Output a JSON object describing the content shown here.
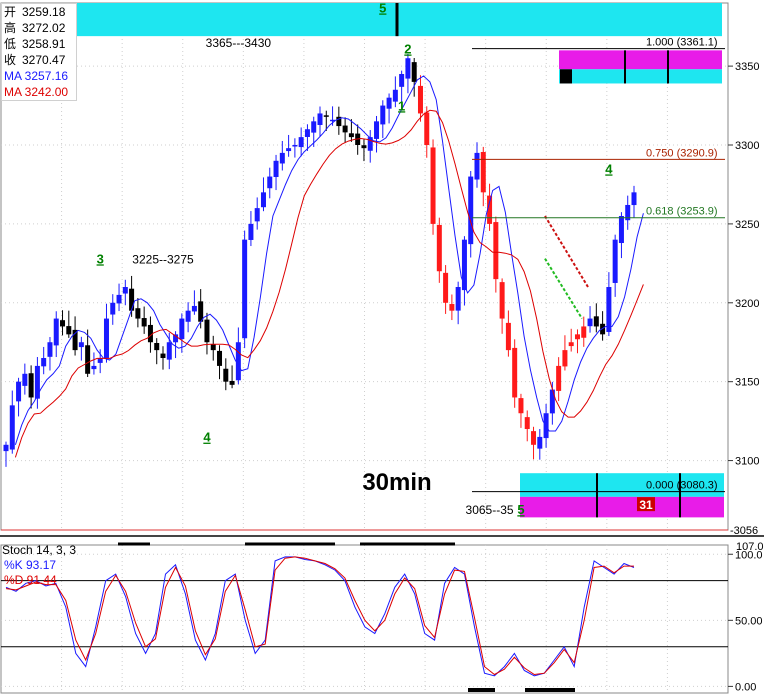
{
  "ohlc_panel": {
    "rows": [
      {
        "label": "开",
        "value": "3259.18"
      },
      {
        "label": "高",
        "value": "3272.02"
      },
      {
        "label": "低",
        "value": "3258.91"
      },
      {
        "label": "收",
        "value": "3270.47"
      }
    ],
    "ma_blue": "MA 3257.16",
    "ma_red": "MA 3242.00"
  },
  "stoch_panel": {
    "title": "Stoch 14, 3, 3",
    "k_text": "%K  93.17",
    "d_text": "%D  91.44"
  },
  "colors": {
    "bull": "#1a1aff",
    "bear": "#ff1a1a",
    "neutral_candle": "#000000",
    "cyan_zone": "#1ee6f0",
    "magenta_zone": "#e81ce8",
    "ma_blue": "#1a1aff",
    "ma_red": "#dd0000",
    "wave_label": "#008000",
    "fib_red": "#aa2200",
    "fib_green": "#227722"
  },
  "chart_data": [
    {
      "type": "candlestick",
      "title": "",
      "watermark": "30min",
      "ylim": [
        3056,
        3390
      ],
      "y_ticks": [
        3100,
        3150,
        3200,
        3250,
        3300,
        3350
      ],
      "y_last_price_tag": "3056",
      "close_path": [
        3110,
        3135,
        3150,
        3155,
        3140,
        3160,
        3165,
        3175,
        3190,
        3185,
        3180,
        3170,
        3175,
        3155,
        3160,
        3165,
        3190,
        3200,
        3205,
        3210,
        3195,
        3190,
        3185,
        3175,
        3170,
        3165,
        3175,
        3180,
        3190,
        3195,
        3198,
        3188,
        3175,
        3170,
        3160,
        3150,
        3148,
        3175,
        3240,
        3250,
        3260,
        3270,
        3280,
        3290,
        3295,
        3298,
        3300,
        3305,
        3310,
        3315,
        3320,
        3318,
        3316,
        3312,
        3308,
        3305,
        3300,
        3298,
        3305,
        3315,
        3325,
        3330,
        3335,
        3345,
        3355,
        3340,
        3320,
        3300,
        3250,
        3220,
        3200,
        3195,
        3210,
        3240,
        3280,
        3295,
        3270,
        3250,
        3215,
        3190,
        3170,
        3140,
        3130,
        3120,
        3110,
        3115,
        3130,
        3145,
        3160,
        3170,
        3175,
        3180,
        3185,
        3190,
        3185,
        3180,
        3210,
        3240,
        3255,
        3262,
        3270
      ],
      "wave_labels": [
        {
          "text": "5",
          "x_index": 60,
          "price": 3384
        },
        {
          "text": "2",
          "x_index": 64,
          "price": 3358
        },
        {
          "text": "1",
          "x_index": 63,
          "price": 3322
        },
        {
          "text": "3",
          "x_index": 15,
          "price": 3225
        },
        {
          "text": "4",
          "x_index": 32,
          "price": 3112
        },
        {
          "text": "4",
          "x_index": 96,
          "price": 3282
        },
        {
          "text": "5",
          "x_index": 82,
          "price": 3066
        }
      ],
      "annotations": [
        {
          "text": "3365---3430",
          "x_index": 37,
          "price": 3362
        },
        {
          "text": "3225--3275",
          "x_index": 25,
          "price": 3225
        },
        {
          "text": "3065--35",
          "x_index": 77,
          "price": 3066
        },
        {
          "text": "31",
          "x_index": 95,
          "price": 3080
        }
      ],
      "fibonacci_levels": [
        {
          "label": "1.000 (3361.1)",
          "value": 3361.1,
          "color": "#000000"
        },
        {
          "label": "0.750 (3290.9)",
          "value": 3290.9,
          "color": "#aa2200"
        },
        {
          "label": "0.618 (3253.9)",
          "value": 3253.9,
          "color": "#227722"
        },
        {
          "label": "0.000 (3080.3)",
          "value": 3080.3,
          "color": "#000000"
        }
      ],
      "zones": [
        {
          "color": "cyan",
          "from": 3369,
          "to": 3390
        },
        {
          "color": "magenta",
          "from": 3348,
          "to": 3360
        },
        {
          "color": "cyan",
          "from": 3339,
          "to": 3348
        },
        {
          "color": "cyan",
          "from": 3077,
          "to": 3092
        },
        {
          "color": "magenta",
          "from": 3064,
          "to": 3077
        }
      ]
    },
    {
      "type": "line",
      "title": "Stoch 14, 3, 3",
      "ylim": [
        -5,
        107
      ],
      "y_ticks": [
        0,
        50,
        100
      ],
      "y_tick_labels": [
        "0.00",
        "50.00",
        "100.0"
      ],
      "y_top_label": "107.0",
      "ref_lines": [
        30,
        80
      ],
      "series": [
        {
          "name": "%K",
          "values": [
            75,
            72,
            78,
            80,
            76,
            78,
            60,
            25,
            15,
            45,
            80,
            85,
            68,
            40,
            25,
            40,
            85,
            92,
            70,
            35,
            20,
            40,
            80,
            85,
            50,
            25,
            35,
            95,
            98,
            98,
            96,
            95,
            92,
            88,
            80,
            60,
            45,
            40,
            55,
            75,
            85,
            70,
            40,
            35,
            78,
            90,
            85,
            45,
            10,
            8,
            15,
            25,
            12,
            8,
            10,
            20,
            30,
            15,
            60,
            95,
            90,
            85,
            93,
            90
          ],
          "color": "#1a1aff"
        },
        {
          "name": "%D",
          "values": [
            74,
            73,
            76,
            79,
            77,
            77,
            65,
            35,
            20,
            40,
            72,
            84,
            72,
            48,
            30,
            36,
            75,
            90,
            76,
            42,
            24,
            36,
            72,
            84,
            58,
            30,
            32,
            88,
            97,
            98,
            97,
            95,
            93,
            89,
            82,
            65,
            50,
            42,
            50,
            70,
            82,
            74,
            46,
            37,
            70,
            88,
            87,
            52,
            15,
            9,
            13,
            22,
            14,
            9,
            10,
            18,
            28,
            18,
            50,
            90,
            91,
            86,
            91,
            91
          ],
          "color": "#dd0000"
        }
      ]
    }
  ]
}
